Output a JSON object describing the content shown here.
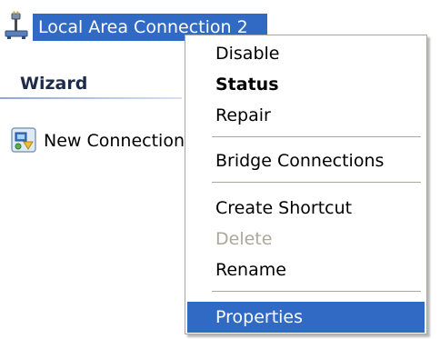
{
  "connection": {
    "label": "Local Area Connection 2",
    "icon": "network-connection-icon"
  },
  "wizard": {
    "header": "Wizard",
    "item_label": "New Connection Wizard",
    "item_icon": "new-connection-wizard-icon"
  },
  "context_menu": {
    "items": [
      {
        "label": "Disable",
        "style": "normal"
      },
      {
        "label": "Status",
        "style": "bold"
      },
      {
        "label": "Repair",
        "style": "normal"
      },
      {
        "label": "Bridge Connections",
        "style": "normal"
      },
      {
        "label": "Create Shortcut",
        "style": "normal"
      },
      {
        "label": "Delete",
        "style": "disabled"
      },
      {
        "label": "Rename",
        "style": "normal"
      },
      {
        "label": "Properties",
        "style": "selected"
      }
    ]
  },
  "colors": {
    "selection": "#316ac5",
    "disabled_text": "#aca899",
    "menu_border": "#aca899"
  }
}
